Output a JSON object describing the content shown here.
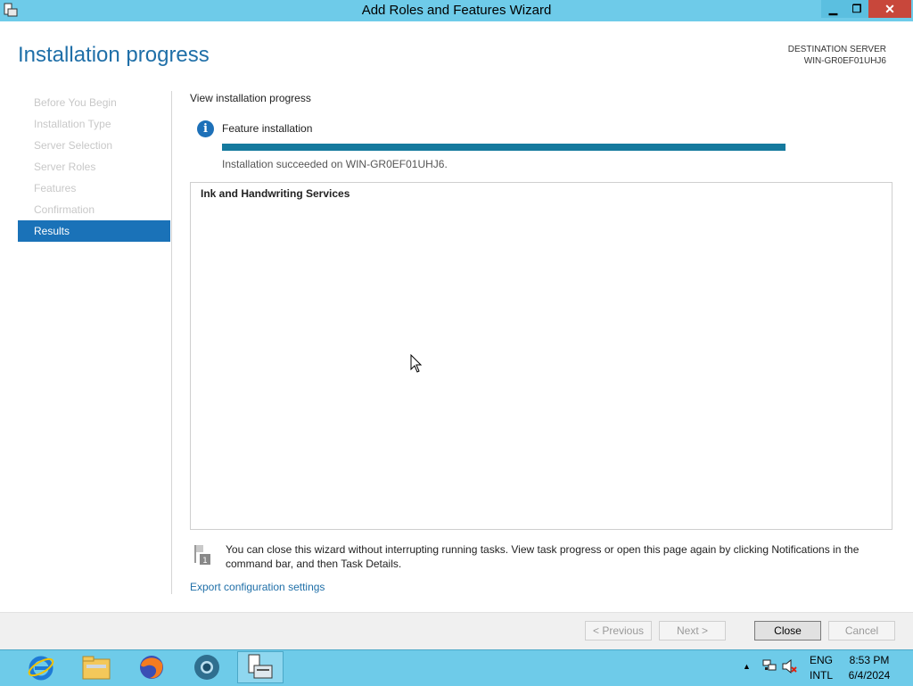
{
  "window": {
    "title": "Add Roles and Features Wizard",
    "minimize_glyph": "▁",
    "maximize_glyph": "❐",
    "close_glyph": "✕"
  },
  "header": {
    "page_title": "Installation progress",
    "destination_label": "DESTINATION SERVER",
    "destination_name": "WIN-GR0EF01UHJ6"
  },
  "nav": {
    "items": [
      {
        "label": "Before You Begin"
      },
      {
        "label": "Installation Type"
      },
      {
        "label": "Server Selection"
      },
      {
        "label": "Server Roles"
      },
      {
        "label": "Features"
      },
      {
        "label": "Confirmation"
      },
      {
        "label": "Results"
      }
    ],
    "active_index": 6
  },
  "content": {
    "view_progress_label": "View installation progress",
    "info_glyph": "i",
    "feature_installation_label": "Feature installation",
    "progress_fraction": 1.0,
    "progress_color": "#157a9e",
    "status_text": "Installation succeeded on WIN-GR0EF01UHJ6.",
    "result_feature": "Ink and Handwriting Services",
    "note_text": "You can close this wizard without interrupting running tasks. View task progress or open this page again by clicking Notifications in the command bar, and then Task Details.",
    "export_link": "Export configuration settings"
  },
  "footer": {
    "previous_label": "< Previous",
    "next_label": "Next >",
    "close_label": "Close",
    "cancel_label": "Cancel"
  },
  "taskbar": {
    "apps": [
      "internet-explorer-icon",
      "file-explorer-icon",
      "firefox-icon",
      "chrome-icon",
      "server-manager-icon"
    ],
    "tray_chevron": "▲",
    "lang_line1": "ENG",
    "lang_line2": "INTL",
    "time": "8:53 PM",
    "date": "6/4/2024"
  },
  "colors": {
    "accent": "#1a72b8",
    "titlebar": "#6ecbe9",
    "close_red": "#c8473b"
  }
}
